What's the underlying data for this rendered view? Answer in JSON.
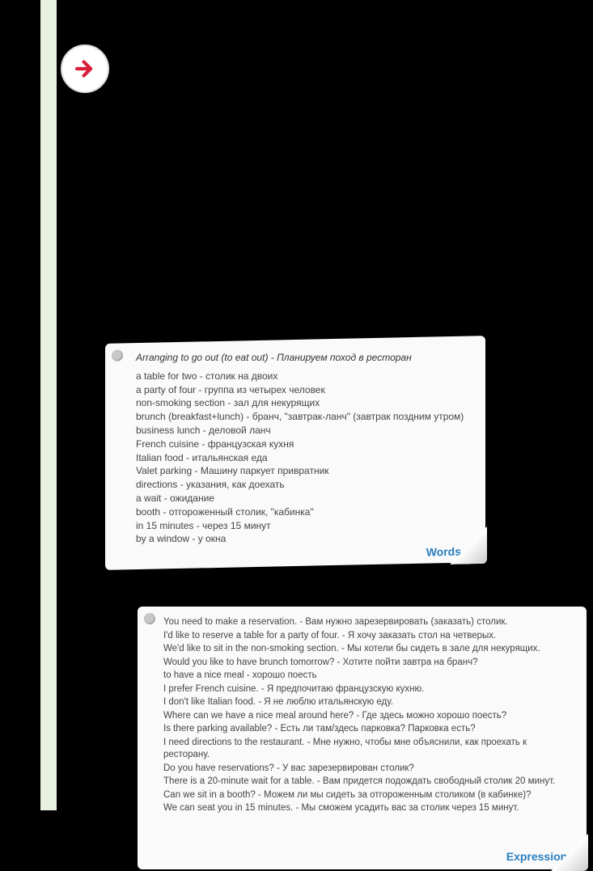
{
  "words": {
    "title": "Arranging to go out (to eat out) - Планируем поход в ресторан",
    "label": "Words",
    "lines": [
      "a table for two - столик на двоих",
      "a party of four - группа из четырех человек",
      "non-smoking section - зал для некурящих",
      "brunch (breakfast+lunch) - бранч, \"завтрак-ланч\" (завтрак поздним утром)",
      "business lunch - деловой ланч",
      "French cuisine - французская кухня",
      "Italian food - итальянская еда",
      "Valet parking - Машину паркует привратник",
      "directions - указания, как доехать",
      "a wait - ожидание",
      "booth - отгороженный столик, \"кабинка\"",
      "in 15 minutes - через 15 минут",
      "by a window - у окна"
    ]
  },
  "expressions": {
    "label": "Expressions",
    "lines": [
      "You need to make a reservation. - Вам нужно зарезервировать (заказать) столик.",
      "I'd like to reserve a table for a party of four. - Я хочу заказать стол на четверых.",
      "We'd like to sit in the non-smoking section. - Мы хотели бы сидеть в зале для некурящих.",
      "Would you like to have brunch tomorrow? - Хотите пойти завтра на бранч?",
      "to have a nice meal - хорошо поесть",
      "I prefer French cuisine. - Я предпочитаю французскую кухню.",
      "I don't like Italian food. - Я не люблю итальянскую еду.",
      "Where can we have a nice meal around here? - Где здесь можно хорошо поесть?",
      "Is there parking available? - Есть ли там/здесь парковка? Парковка есть?",
      "I need directions to the restaurant. - Мне нужно, чтобы мне объяснили, как проехать к ресторану.",
      "Do you have reservations? - У вас зарезервирован столик?",
      "There is a 20-minute wait for a table. - Вам придется подождать свободный столик 20 минут.",
      "Can we sit in a booth? - Можем ли мы сидеть за отгороженным столиком (в кабинке)?",
      "We can seat you in 15 minutes. - Мы сможем усадить вас за столик через 15 минут."
    ]
  }
}
